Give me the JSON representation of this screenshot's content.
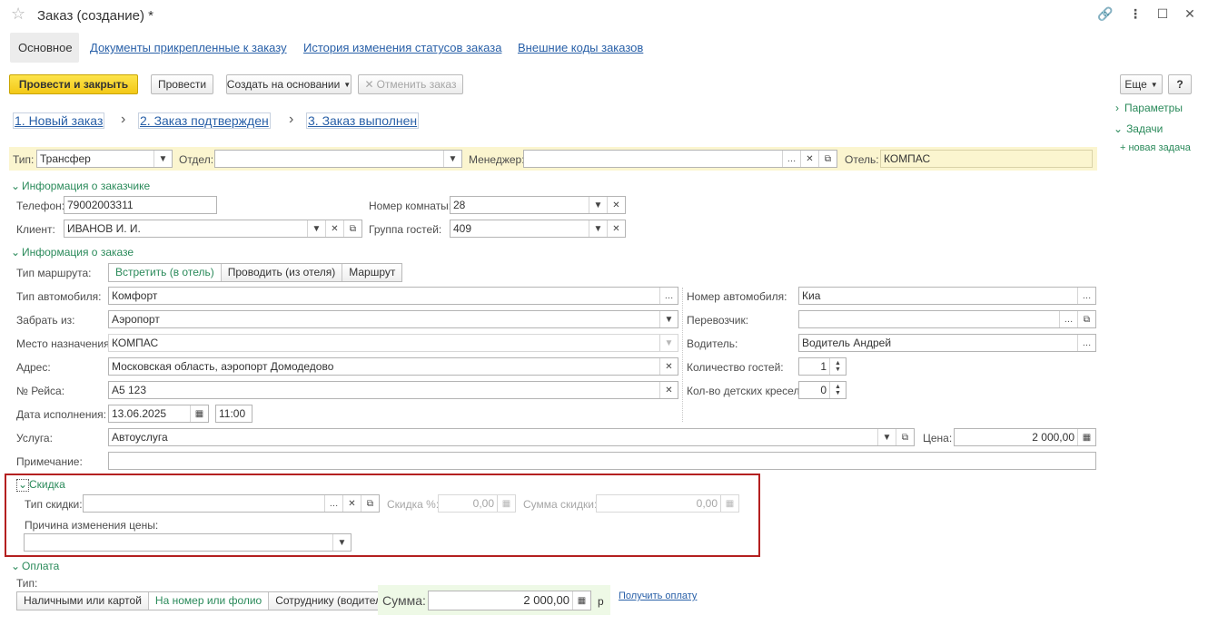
{
  "window": {
    "title": "Заказ (создание) *"
  },
  "tabs": [
    {
      "label": "Основное"
    },
    {
      "label": "Документы прикрепленные к заказу"
    },
    {
      "label": "История изменения статусов заказа"
    },
    {
      "label": "Внешние коды заказов"
    }
  ],
  "toolbar": {
    "post_close": "Провести и закрыть",
    "post": "Провести",
    "create_based": "Создать на основании",
    "cancel_order": "Отменить заказ",
    "more": "Еще",
    "help": "?"
  },
  "steps": [
    "1. Новый заказ",
    "2. Заказ подтвержден",
    "3. Заказ выполнен"
  ],
  "side": {
    "params": "Параметры",
    "tasks": "Задачи",
    "new_task": "+ новая задача"
  },
  "header": {
    "type_label": "Тип:",
    "type_value": "Трансфер",
    "dept_label": "Отдел:",
    "dept_value": "",
    "manager_label": "Менеджер:",
    "manager_value": "",
    "hotel_label": "Отель:",
    "hotel_value": "КОМПАС"
  },
  "customer": {
    "section": "Информация о заказчике",
    "phone_label": "Телефон:",
    "phone_value": "79002003311",
    "client_label": "Клиент:",
    "client_value": "ИВАНОВ И. И.",
    "room_label": "Номер комнаты:",
    "room_value": "28",
    "group_label": "Группа гостей:",
    "group_value": "409"
  },
  "order": {
    "section": "Информация о заказе",
    "route_label": "Тип маршрута:",
    "route_options": [
      "Встретить (в отель)",
      "Проводить (из отеля)",
      "Маршрут"
    ],
    "car_type_label": "Тип автомобиля:",
    "car_type_value": "Комфорт",
    "pickup_label": "Забрать из:",
    "pickup_value": "Аэропорт",
    "dest_label": "Место назначения:",
    "dest_value": "КОМПАС",
    "address_label": "Адрес:",
    "address_value": "Московская область, аэропорт Домодедово",
    "flight_label": "№ Рейса:",
    "flight_value": "А5 123",
    "date_label": "Дата исполнения:",
    "date_value": "13.06.2025",
    "time_value": "11:00",
    "car_num_label": "Номер автомобиля:",
    "car_num_value": "Киа",
    "carrier_label": "Перевозчик:",
    "carrier_value": "",
    "driver_label": "Водитель:",
    "driver_value": "Водитель Андрей",
    "guests_label": "Количество гостей:",
    "guests_value": "1",
    "seats_label": "Кол-во детских кресел:",
    "seats_value": "0",
    "service_label": "Услуга:",
    "service_value": "Автоуслуга",
    "price_label": "Цена:",
    "price_value": "2 000,00",
    "note_label": "Примечание:",
    "note_value": ""
  },
  "discount": {
    "section": "Скидка",
    "type_label": "Тип скидки:",
    "type_value": "",
    "pct_label": "Скидка %:",
    "pct_value": "0,00",
    "sum_label": "Сумма скидки:",
    "sum_value": "0,00",
    "reason_label": "Причина изменения цены:",
    "reason_value": ""
  },
  "payment": {
    "section": "Оплата",
    "type_label": "Тип:",
    "options": [
      "Наличными или картой",
      "На номер или фолио",
      "Сотруднику (водителю)"
    ],
    "sum_label": "Сумма:",
    "sum_value": "2 000,00",
    "currency": "р",
    "get_payment": "Получить оплату"
  }
}
